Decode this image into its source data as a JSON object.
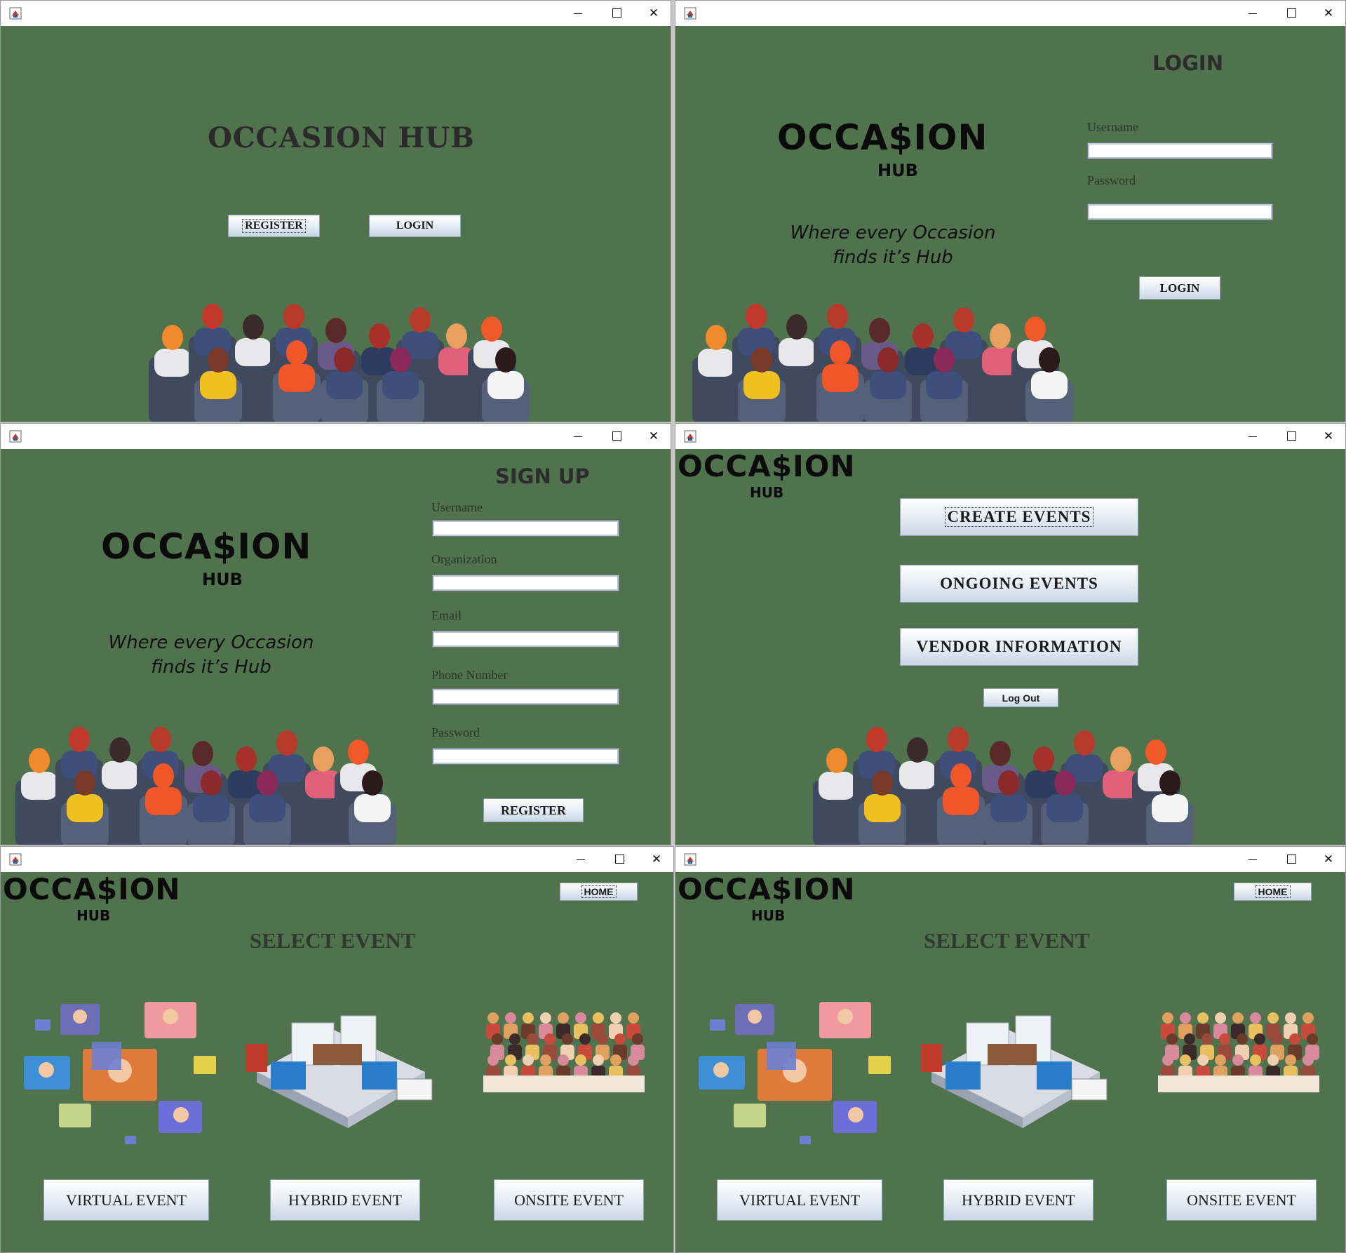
{
  "windows": {
    "home": {
      "title_controls": [
        "minimize",
        "maximize",
        "close"
      ],
      "app_name": "OCCASION HUB",
      "register_label": "REGISTER",
      "login_label": "LOGIN"
    },
    "login": {
      "logo_word": "OCCA$ION",
      "logo_hub": "HUB",
      "tagline_line1": "Where every Occasion",
      "tagline_line2": "finds it’s Hub",
      "heading": "LOGIN",
      "username_label": "Username",
      "username_value": "",
      "password_label": "Password",
      "password_value": "",
      "login_button": "LOGIN"
    },
    "signup": {
      "logo_word": "OCCA$ION",
      "logo_hub": "HUB",
      "tagline_line1": "Where every Occasion",
      "tagline_line2": "finds it’s Hub",
      "heading": "SIGN UP",
      "fields": [
        {
          "label": "Username",
          "value": ""
        },
        {
          "label": "Organization",
          "value": ""
        },
        {
          "label": "Email",
          "value": ""
        },
        {
          "label": "Phone Number",
          "value": ""
        },
        {
          "label": "Password",
          "value": ""
        }
      ],
      "register_button": "REGISTER"
    },
    "dashboard": {
      "logo_word": "OCCA$ION",
      "logo_hub": "HUB",
      "create_events": "CREATE  EVENTS",
      "ongoing_events": "ONGOING  EVENTS",
      "vendor_information": "VENDOR  INFORMATION",
      "log_out": "Log Out"
    },
    "select_event_1": {
      "logo_word": "OCCA$ION",
      "logo_hub": "HUB",
      "home_button": "HOME",
      "heading": "SELECT EVENT",
      "virtual_button": "VIRTUAL EVENT",
      "hybrid_button": "HYBRID EVENT",
      "onsite_button": "ONSITE EVENT"
    },
    "select_event_2": {
      "logo_word": "OCCA$ION",
      "logo_hub": "HUB",
      "home_button": "HOME",
      "heading": "SELECT EVENT",
      "virtual_button": "VIRTUAL EVENT",
      "hybrid_button": "HYBRID EVENT",
      "onsite_button": "ONSITE EVENT"
    }
  },
  "colors": {
    "background_green": "#50734d",
    "button_blue_light": "#e9eff6",
    "text_dark": "#111111"
  },
  "icons": {
    "app_icon": "java-coffee-icon",
    "minimize": "minimize-icon",
    "maximize": "maximize-icon",
    "close": "close-icon"
  }
}
